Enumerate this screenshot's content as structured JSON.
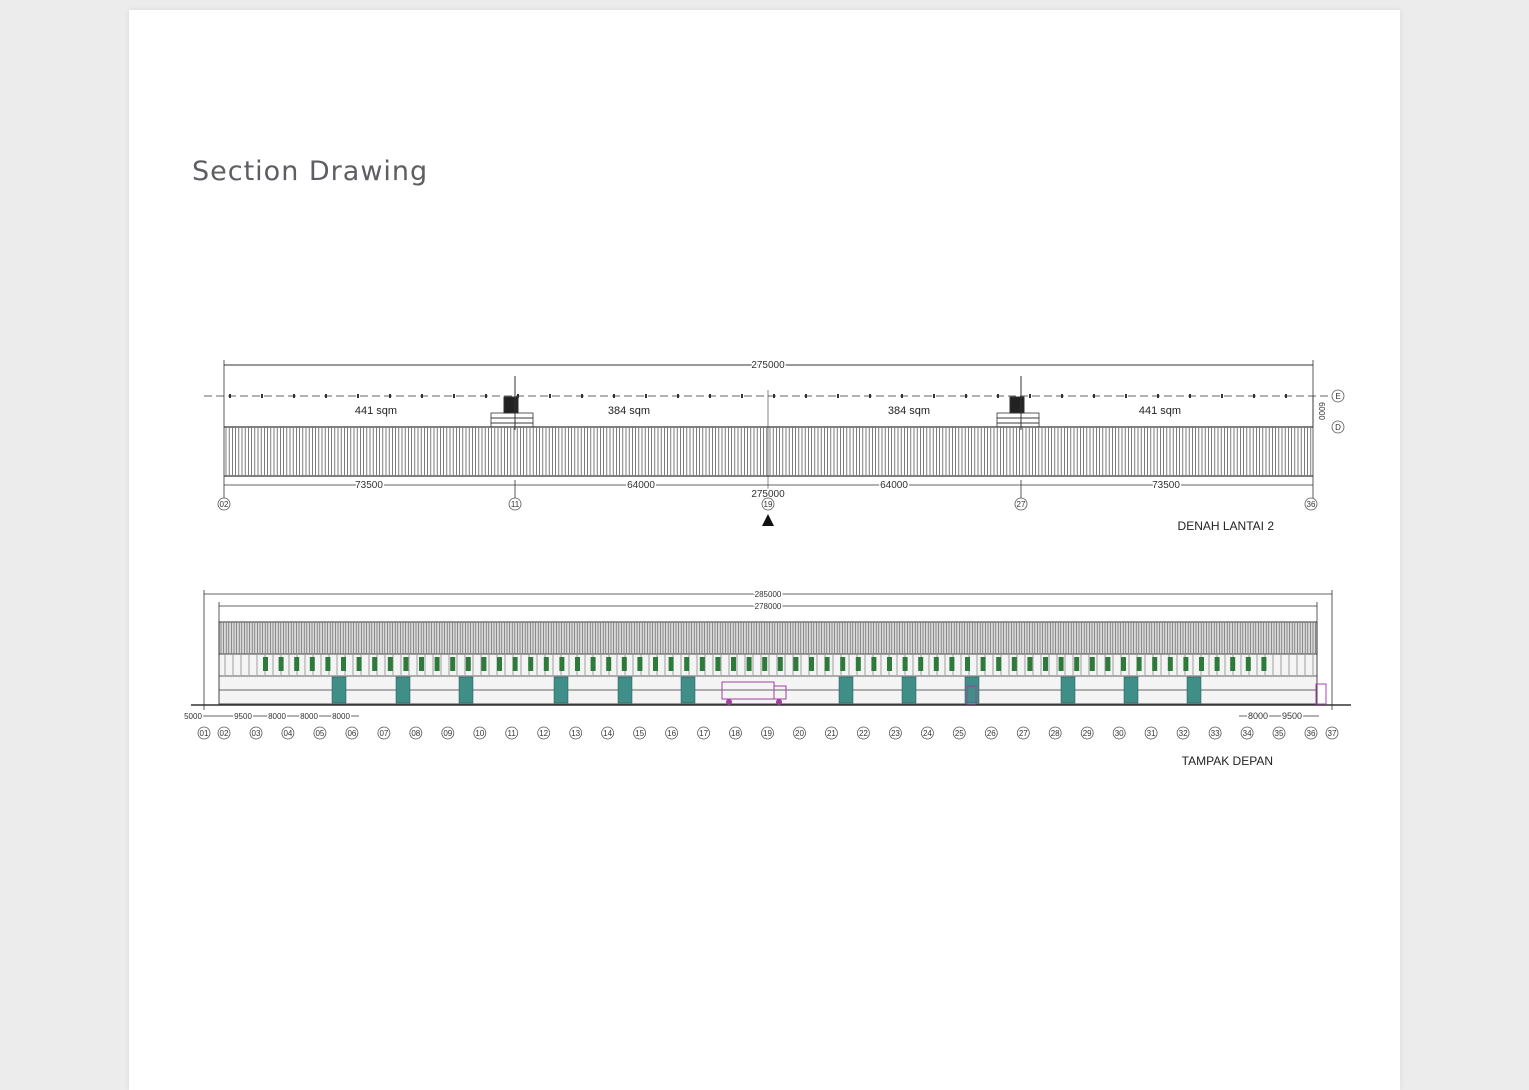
{
  "document": {
    "title": "Section Drawing"
  },
  "floor_plan": {
    "label": "DENAH  LANTAI 2",
    "total_dim_top": "275000",
    "total_dim_bottom": "275000",
    "segment_dims": [
      "73500",
      "64000",
      "64000",
      "73500"
    ],
    "areas": [
      "441 sqm",
      "384 sqm",
      "384 sqm",
      "441 sqm"
    ],
    "row_marks": [
      "E",
      "D"
    ],
    "side_dim": "6000",
    "grid_marks": [
      "02",
      "11",
      "19",
      "27",
      "36"
    ]
  },
  "elevation": {
    "label": "TAMPAK DEPAN",
    "outer_dim": "285000",
    "inner_dim": "278000",
    "left_dims": [
      "5000",
      "9500",
      "8000",
      "8000",
      "8000"
    ],
    "right_dims": [
      "8000",
      "9500"
    ],
    "grid_marks": [
      "01",
      "02",
      "03",
      "04",
      "05",
      "06",
      "07",
      "08",
      "09",
      "10",
      "11",
      "12",
      "13",
      "14",
      "15",
      "16",
      "17",
      "18",
      "19",
      "20",
      "21",
      "22",
      "23",
      "24",
      "25",
      "26",
      "27",
      "28",
      "29",
      "30",
      "31",
      "32",
      "33",
      "34",
      "35",
      "36",
      "37"
    ]
  }
}
